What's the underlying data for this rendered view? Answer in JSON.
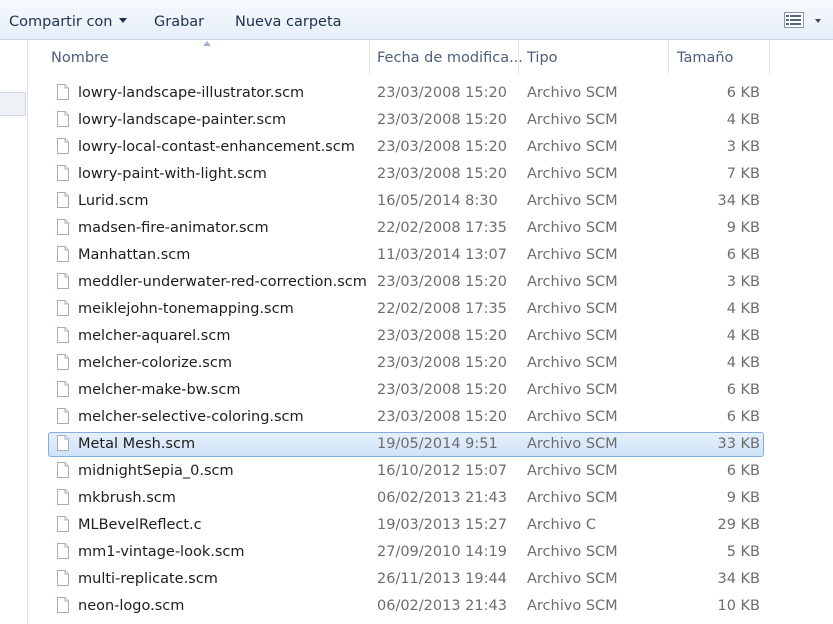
{
  "toolbar": {
    "share_label": "Compartir con",
    "burn_label": "Grabar",
    "new_folder_label": "Nueva carpeta",
    "view_icon": "details-view-icon"
  },
  "columns": {
    "name": "Nombre",
    "date": "Fecha de modifica...",
    "type": "Tipo",
    "size": "Tamaño"
  },
  "files": [
    {
      "name": "lowry-landscape-illustrator.scm",
      "date": "23/03/2008 15:20",
      "type": "Archivo SCM",
      "size": "6 KB"
    },
    {
      "name": "lowry-landscape-painter.scm",
      "date": "23/03/2008 15:20",
      "type": "Archivo SCM",
      "size": "4 KB"
    },
    {
      "name": "lowry-local-contast-enhancement.scm",
      "date": "23/03/2008 15:20",
      "type": "Archivo SCM",
      "size": "3 KB"
    },
    {
      "name": "lowry-paint-with-light.scm",
      "date": "23/03/2008 15:20",
      "type": "Archivo SCM",
      "size": "7 KB"
    },
    {
      "name": "Lurid.scm",
      "date": "16/05/2014 8:30",
      "type": "Archivo SCM",
      "size": "34 KB"
    },
    {
      "name": "madsen-fire-animator.scm",
      "date": "22/02/2008 17:35",
      "type": "Archivo SCM",
      "size": "9 KB"
    },
    {
      "name": "Manhattan.scm",
      "date": "11/03/2014 13:07",
      "type": "Archivo SCM",
      "size": "6 KB"
    },
    {
      "name": "meddler-underwater-red-correction.scm",
      "date": "23/03/2008 15:20",
      "type": "Archivo SCM",
      "size": "3 KB"
    },
    {
      "name": "meiklejohn-tonemapping.scm",
      "date": "22/02/2008 17:35",
      "type": "Archivo SCM",
      "size": "4 KB"
    },
    {
      "name": "melcher-aquarel.scm",
      "date": "23/03/2008 15:20",
      "type": "Archivo SCM",
      "size": "4 KB"
    },
    {
      "name": "melcher-colorize.scm",
      "date": "23/03/2008 15:20",
      "type": "Archivo SCM",
      "size": "4 KB"
    },
    {
      "name": "melcher-make-bw.scm",
      "date": "23/03/2008 15:20",
      "type": "Archivo SCM",
      "size": "6 KB"
    },
    {
      "name": "melcher-selective-coloring.scm",
      "date": "23/03/2008 15:20",
      "type": "Archivo SCM",
      "size": "6 KB"
    },
    {
      "name": "Metal Mesh.scm",
      "date": "19/05/2014 9:51",
      "type": "Archivo SCM",
      "size": "33 KB",
      "selected": true
    },
    {
      "name": "midnightSepia_0.scm",
      "date": "16/10/2012 15:07",
      "type": "Archivo SCM",
      "size": "6 KB"
    },
    {
      "name": "mkbrush.scm",
      "date": "06/02/2013 21:43",
      "type": "Archivo SCM",
      "size": "9 KB"
    },
    {
      "name": "MLBevelReflect.c",
      "date": "19/03/2013 15:27",
      "type": "Archivo C",
      "size": "29 KB"
    },
    {
      "name": "mm1-vintage-look.scm",
      "date": "27/09/2010 14:19",
      "type": "Archivo SCM",
      "size": "5 KB"
    },
    {
      "name": "multi-replicate.scm",
      "date": "26/11/2013 19:44",
      "type": "Archivo SCM",
      "size": "34 KB"
    },
    {
      "name": "neon-logo.scm",
      "date": "06/02/2013 21:43",
      "type": "Archivo SCM",
      "size": "10 KB"
    }
  ]
}
